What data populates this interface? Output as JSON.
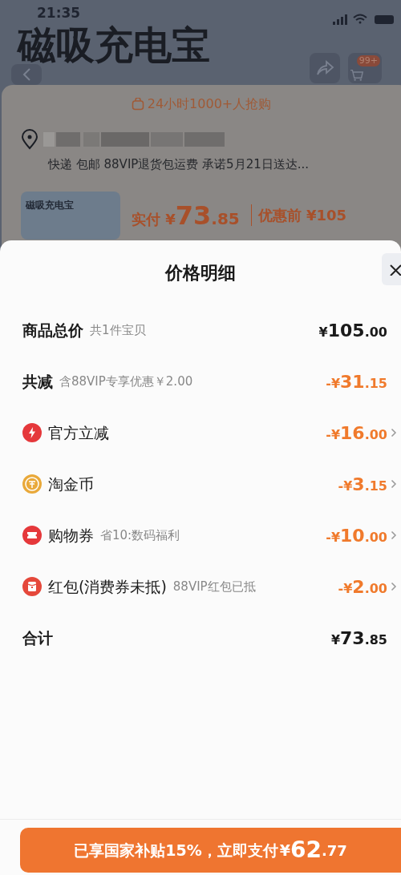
{
  "status_bar": {
    "time": "21:35"
  },
  "product_page": {
    "title": "磁吸充电宝",
    "cart_badge": "99+",
    "hot_notice": "24小时1000+人抢购",
    "delivery": "快递 包邮 88VIP退货包运费 承诺5月21日送达...",
    "thumbnail_title": "磁吸充电宝",
    "paid_label": "实付",
    "paid_yen": "¥",
    "paid_int": "73",
    "paid_dec": ".85",
    "before_label": "优惠前 ¥105"
  },
  "sheet": {
    "title": "价格明细",
    "rows": [
      {
        "kind": "total",
        "label": "商品总价",
        "note": "共1件宝贝",
        "sign": "¥",
        "int": "105",
        "dec": ".00",
        "expandable": false
      },
      {
        "kind": "discount",
        "label": "共减",
        "note": "含88VIP专享优惠￥2.00",
        "sign": "-¥",
        "int": "31",
        "dec": ".15",
        "expandable": false
      },
      {
        "kind": "lightning",
        "label": "官方立减",
        "sign": "-¥",
        "int": "16",
        "dec": ".00",
        "expandable": true
      },
      {
        "kind": "coin",
        "label": "淘金币",
        "sign": "-¥",
        "int": "3",
        "dec": ".15",
        "expandable": true
      },
      {
        "kind": "coupon",
        "label": "购物券",
        "note": "省10:数码福利",
        "sign": "-¥",
        "int": "10",
        "dec": ".00",
        "expandable": true
      },
      {
        "kind": "envelope",
        "label": "红包(消费券未抵)",
        "note": "88VIP红包已抵",
        "sign": "-¥",
        "int": "2",
        "dec": ".00",
        "expandable": true
      },
      {
        "kind": "total",
        "label": "合计",
        "sign": "¥",
        "int": "73",
        "dec": ".85",
        "expandable": false
      }
    ],
    "pay_button": {
      "text": "已享国家补贴15%，立即支付",
      "yen": "¥",
      "int": "62",
      "dec": ".77"
    }
  }
}
